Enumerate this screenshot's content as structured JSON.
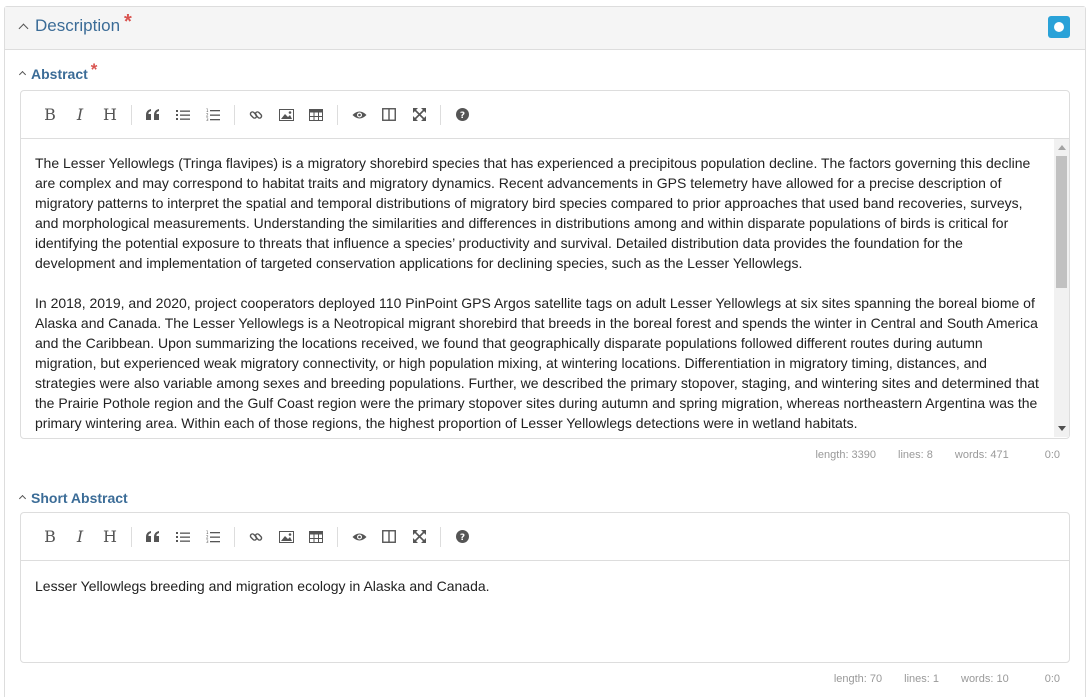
{
  "panel": {
    "title": "Description",
    "required_mark": "*"
  },
  "abstract": {
    "label": "Abstract",
    "required_mark": "*",
    "paragraphs": [
      "The Lesser Yellowlegs (Tringa flavipes) is a migratory shorebird species that has experienced a precipitous population decline. The factors governing this decline are complex and may correspond to habitat traits and migratory dynamics. Recent advancements in GPS telemetry have allowed for a precise description of migratory patterns to interpret the spatial and temporal distributions of migratory bird species compared to prior approaches that used band recoveries, surveys, and morphological measurements. Understanding the similarities and differences in distributions among and within disparate populations of birds is critical for identifying the potential exposure to threats that influence a species’ productivity and survival. Detailed distribution data provides the foundation for the development and implementation of targeted conservation applications for declining species, such as the Lesser Yellowlegs.",
      "In 2018, 2019, and 2020, project cooperators deployed 110 PinPoint GPS Argos satellite tags on adult Lesser Yellowlegs at six sites spanning the boreal biome of Alaska and Canada. The Lesser Yellowlegs is a Neotropical migrant shorebird that breeds in the boreal forest and spends the winter in Central and South America and the Caribbean. Upon summarizing the locations received, we found that geographically disparate populations followed different routes during autumn migration, but experienced weak migratory connectivity, or high population mixing, at wintering locations. Differentiation in migratory timing, distances, and strategies were also variable among sexes and breeding populations. Further, we described the primary stopover, staging, and wintering sites and determined that the Prairie Pothole region and the Gulf Coast region were the primary stopover sites during autumn and spring migration, whereas northeastern Argentina was the primary wintering area. Within each of those regions, the highest proportion of Lesser Yellowlegs detections were in wetland habitats."
    ],
    "status": {
      "length": "length: 3390",
      "lines": "lines: 8",
      "words": "words: 471",
      "cursor": "0:0"
    }
  },
  "short_abstract": {
    "label": "Short Abstract",
    "text": "Lesser Yellowlegs breeding and migration ecology in Alaska and Canada.",
    "status": {
      "length": "length: 70",
      "lines": "lines: 1",
      "words": "words: 10",
      "cursor": "0:0"
    }
  },
  "toolbar": {
    "bold": "B",
    "italic": "I",
    "heading": "H",
    "icons": [
      "bold-icon",
      "italic-icon",
      "heading-icon",
      "quote-icon",
      "unordered-list-icon",
      "ordered-list-icon",
      "link-icon",
      "image-icon",
      "table-icon",
      "preview-icon",
      "side-by-side-icon",
      "fullscreen-icon",
      "help-icon"
    ]
  },
  "colors": {
    "accent": "#3b6c97",
    "required": "#d9534f",
    "toggle": "#2aa2d8"
  },
  "scroll": {
    "abstract_thumb_fraction": 0.5
  }
}
